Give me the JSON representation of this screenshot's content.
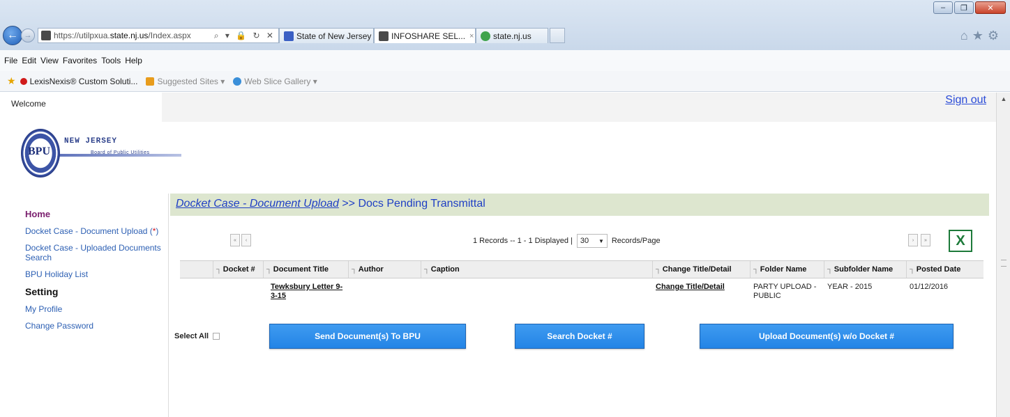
{
  "browser": {
    "url_prefix": "https://utilpxua.",
    "url_host": "state.nj.us",
    "url_path": "/Index.aspx",
    "address_icons": "⌕ ▾ 🔒 ↻ ✕",
    "tabs": [
      {
        "label": "State of New Jersey"
      },
      {
        "label": "INFOSHARE SEL...",
        "close": "×"
      },
      {
        "label": "state.nj.us"
      }
    ],
    "menu": [
      "File",
      "Edit",
      "View",
      "Favorites",
      "Tools",
      "Help"
    ],
    "favorites": {
      "lexis": "LexisNexis® Custom Soluti...",
      "suggested": "Suggested Sites ▾",
      "webslice": "Web Slice Gallery ▾"
    },
    "window_buttons": {
      "minimize": "–",
      "maximize": "❐",
      "close": "✕"
    },
    "right_icons": "⌂★⚙"
  },
  "header": {
    "welcome": "Welcome",
    "sign_out": "Sign out"
  },
  "logo": {
    "seal_text": "BPU",
    "title": "NEW JERSEY",
    "subtitle": "Board of Public Utilities"
  },
  "sidebar": {
    "home": "Home",
    "doc_upload": "Docket Case - Document Upload (",
    "doc_upload_req": "*",
    "doc_upload_end": ")",
    "uploaded_search": "Docket Case - Uploaded Documents Search",
    "holiday": "BPU Holiday List",
    "setting": "Setting",
    "profile": "My Profile",
    "change_password": "Change Password"
  },
  "breadcrumb": {
    "link": "Docket Case - Document Upload",
    "sep": " >> ",
    "current": "Docs Pending Transmittal"
  },
  "pager": {
    "info": "1 Records -- 1 - 1 Displayed |",
    "per_page": "30",
    "per_page_label": "Records/Page",
    "first": "«",
    "prev": "‹",
    "next": "›",
    "last": "»",
    "excel": "X"
  },
  "grid": {
    "sort_glyph": "┐",
    "columns": [
      "Docket #",
      "Document Title",
      "Author",
      "Caption",
      "Change Title/Detail",
      "Folder Name",
      "Subfolder Name",
      "Posted Date"
    ],
    "rows": [
      {
        "docket": "",
        "title": "Tewksbury Letter 9-3-15",
        "author": "",
        "caption": "",
        "change": "Change Title/Detail",
        "folder": "PARTY UPLOAD - PUBLIC",
        "subfolder": "YEAR - 2015",
        "posted": "01/12/2016"
      }
    ]
  },
  "actions": {
    "select_all": "Select All",
    "send": "Send Document(s) To BPU",
    "search": "Search Docket #",
    "upload": "Upload Document(s) w/o Docket #"
  }
}
